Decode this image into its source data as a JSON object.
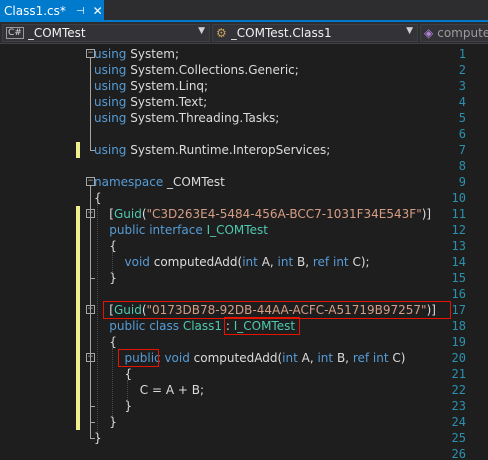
{
  "tab": {
    "title": "Class1.cs*",
    "pin_glyph": "⊣",
    "close_glyph": "✕"
  },
  "navbar": {
    "project_label": "_COMTest",
    "project_icon": "C#",
    "class_label": "_COMTest.Class1",
    "member_label": "compute"
  },
  "lines": [
    {
      "n": "1",
      "tokens": [
        [
          "k",
          "using"
        ],
        [
          "p",
          " System;"
        ]
      ]
    },
    {
      "n": "2",
      "tokens": [
        [
          "k",
          "using"
        ],
        [
          "p",
          " System.Collections.Generic;"
        ]
      ]
    },
    {
      "n": "3",
      "tokens": [
        [
          "k",
          "using"
        ],
        [
          "p",
          " System.Linq;"
        ]
      ]
    },
    {
      "n": "4",
      "tokens": [
        [
          "k",
          "using"
        ],
        [
          "p",
          " System.Text;"
        ]
      ]
    },
    {
      "n": "5",
      "tokens": [
        [
          "k",
          "using"
        ],
        [
          "p",
          " System.Threading.Tasks;"
        ]
      ]
    },
    {
      "n": "6",
      "tokens": []
    },
    {
      "n": "7",
      "tokens": [
        [
          "k",
          "using"
        ],
        [
          "p",
          " System.Runtime.InteropServices;"
        ]
      ]
    },
    {
      "n": "8",
      "tokens": []
    },
    {
      "n": "9",
      "tokens": [
        [
          "k",
          "namespace"
        ],
        [
          "p",
          " _COMTest"
        ]
      ]
    },
    {
      "n": "10",
      "tokens": [
        [
          "p",
          "{"
        ]
      ]
    },
    {
      "n": "11",
      "tokens": [
        [
          "p",
          "    ["
        ],
        [
          "t",
          "Guid"
        ],
        [
          "p",
          "("
        ],
        [
          "s",
          "\"C3D263E4-5484-456A-BCC7-1031F34E543F\""
        ],
        [
          "p",
          ")]"
        ]
      ]
    },
    {
      "n": "12",
      "tokens": [
        [
          "p",
          "    "
        ],
        [
          "k",
          "public"
        ],
        [
          "p",
          " "
        ],
        [
          "k",
          "interface"
        ],
        [
          "p",
          " "
        ],
        [
          "t",
          "I_COMTest"
        ]
      ]
    },
    {
      "n": "13",
      "tokens": [
        [
          "p",
          "    {"
        ]
      ]
    },
    {
      "n": "14",
      "tokens": [
        [
          "p",
          "        "
        ],
        [
          "k",
          "void"
        ],
        [
          "p",
          " computedAdd("
        ],
        [
          "k",
          "int"
        ],
        [
          "p",
          " A, "
        ],
        [
          "k",
          "int"
        ],
        [
          "p",
          " B, "
        ],
        [
          "k",
          "ref"
        ],
        [
          "p",
          " "
        ],
        [
          "k",
          "int"
        ],
        [
          "p",
          " C);"
        ]
      ]
    },
    {
      "n": "15",
      "tokens": [
        [
          "p",
          "    }"
        ]
      ]
    },
    {
      "n": "16",
      "tokens": []
    },
    {
      "n": "17",
      "tokens": [
        [
          "p",
          "    ["
        ],
        [
          "t",
          "Guid"
        ],
        [
          "p",
          "("
        ],
        [
          "s",
          "\"0173DB78-92DB-44AA-ACFC-A51719B97257\""
        ],
        [
          "p",
          ")]"
        ]
      ]
    },
    {
      "n": "18",
      "tokens": [
        [
          "p",
          "    "
        ],
        [
          "k",
          "public"
        ],
        [
          "p",
          " "
        ],
        [
          "k",
          "class"
        ],
        [
          "p",
          " "
        ],
        [
          "t",
          "Class1"
        ],
        [
          "p",
          " : "
        ],
        [
          "t",
          "I_COMTest"
        ]
      ]
    },
    {
      "n": "19",
      "tokens": [
        [
          "p",
          "    {"
        ]
      ]
    },
    {
      "n": "20",
      "tokens": [
        [
          "p",
          "        "
        ],
        [
          "k",
          "public"
        ],
        [
          "p",
          " "
        ],
        [
          "k",
          "void"
        ],
        [
          "p",
          " computedAdd("
        ],
        [
          "k",
          "int"
        ],
        [
          "p",
          " A, "
        ],
        [
          "k",
          "int"
        ],
        [
          "p",
          " B, "
        ],
        [
          "k",
          "ref"
        ],
        [
          "p",
          " "
        ],
        [
          "k",
          "int"
        ],
        [
          "p",
          " C)"
        ]
      ]
    },
    {
      "n": "21",
      "tokens": [
        [
          "p",
          "        {"
        ]
      ]
    },
    {
      "n": "22",
      "tokens": [
        [
          "p",
          "            C = A + B;"
        ]
      ]
    },
    {
      "n": "23",
      "tokens": [
        [
          "p",
          "        }"
        ]
      ]
    },
    {
      "n": "24",
      "tokens": [
        [
          "p",
          "    }"
        ]
      ]
    },
    {
      "n": "25",
      "tokens": [
        [
          "p",
          "}"
        ]
      ]
    },
    {
      "n": "26",
      "tokens": []
    }
  ],
  "modified_lines": [
    "7",
    "11",
    "12",
    "13",
    "14",
    "15",
    "16",
    "17",
    "18",
    "19",
    "20",
    "21",
    "22",
    "23",
    "24"
  ],
  "colors": {
    "keyword": "#569cd6",
    "type": "#4ec9b0",
    "string": "#d69d85",
    "line_number": "#2b91af",
    "accent": "#007acc",
    "highlight_box": "#e51400"
  }
}
